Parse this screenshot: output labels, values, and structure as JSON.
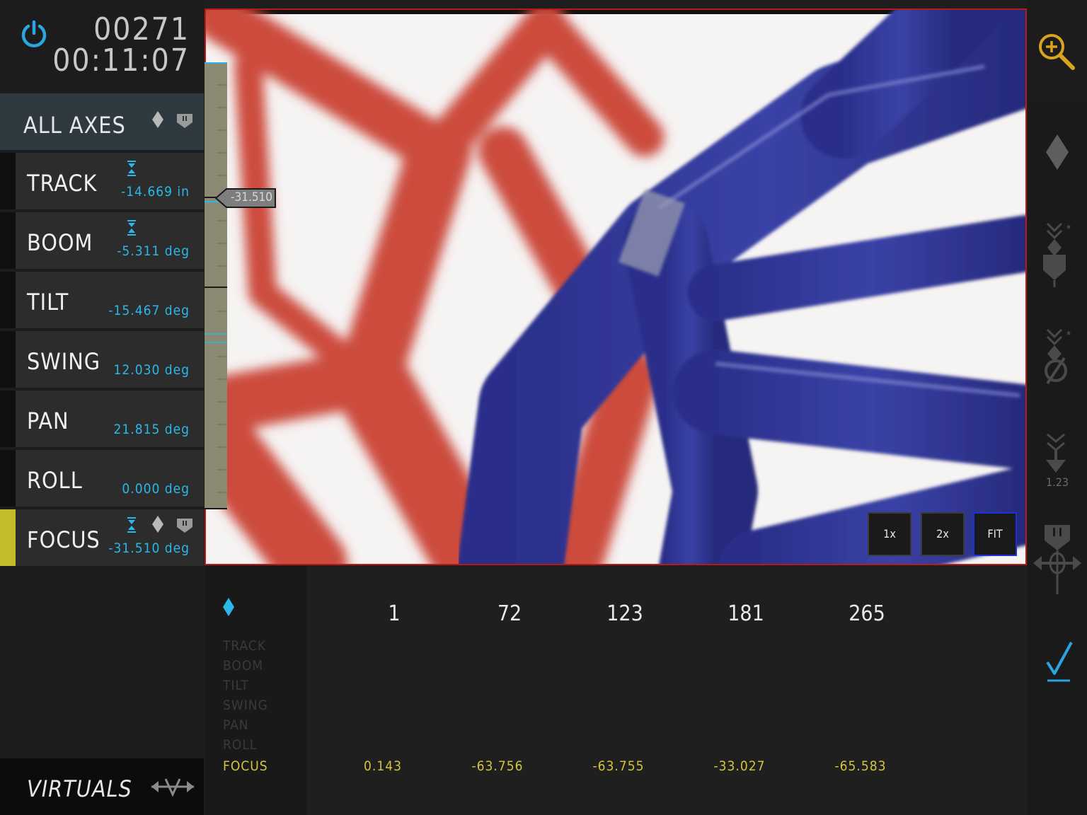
{
  "header": {
    "counter_frames": "00271",
    "counter_time": "00:11:07"
  },
  "all_axes": {
    "label": "ALL AXES"
  },
  "axes": [
    {
      "name": "TRACK",
      "value": "-14.669 in"
    },
    {
      "name": "BOOM",
      "value": "-5.311 deg"
    },
    {
      "name": "TILT",
      "value": "-15.467 deg"
    },
    {
      "name": "SWING",
      "value": "12.030 deg"
    },
    {
      "name": "PAN",
      "value": "21.815 deg"
    },
    {
      "name": "ROLL",
      "value": "0.000 deg"
    },
    {
      "name": "FOCUS",
      "value": "-31.510 deg"
    }
  ],
  "virtuals": {
    "label": "VIRTUALS"
  },
  "viewport": {
    "scale_readout": "-31.510",
    "zoom_buttons": [
      "1x",
      "2x",
      "FIT"
    ],
    "selected_zoom": "FIT"
  },
  "keyframes": {
    "axis_names": [
      "TRACK",
      "BOOM",
      "TILT",
      "SWING",
      "PAN",
      "ROLL",
      "FOCUS"
    ],
    "frames": [
      "1",
      "72",
      "123",
      "181",
      "265"
    ],
    "focus_values": [
      "0.143",
      "-63.756",
      "-63.755",
      "-33.027",
      "-65.583"
    ]
  },
  "right_panel": {
    "step_label": "1.23"
  },
  "colors": {
    "accent_blue": "#29b8e8",
    "accent_yellow": "#c2bb2a",
    "focus_text": "#d3c43c",
    "frame_border": "#b81a1a"
  }
}
